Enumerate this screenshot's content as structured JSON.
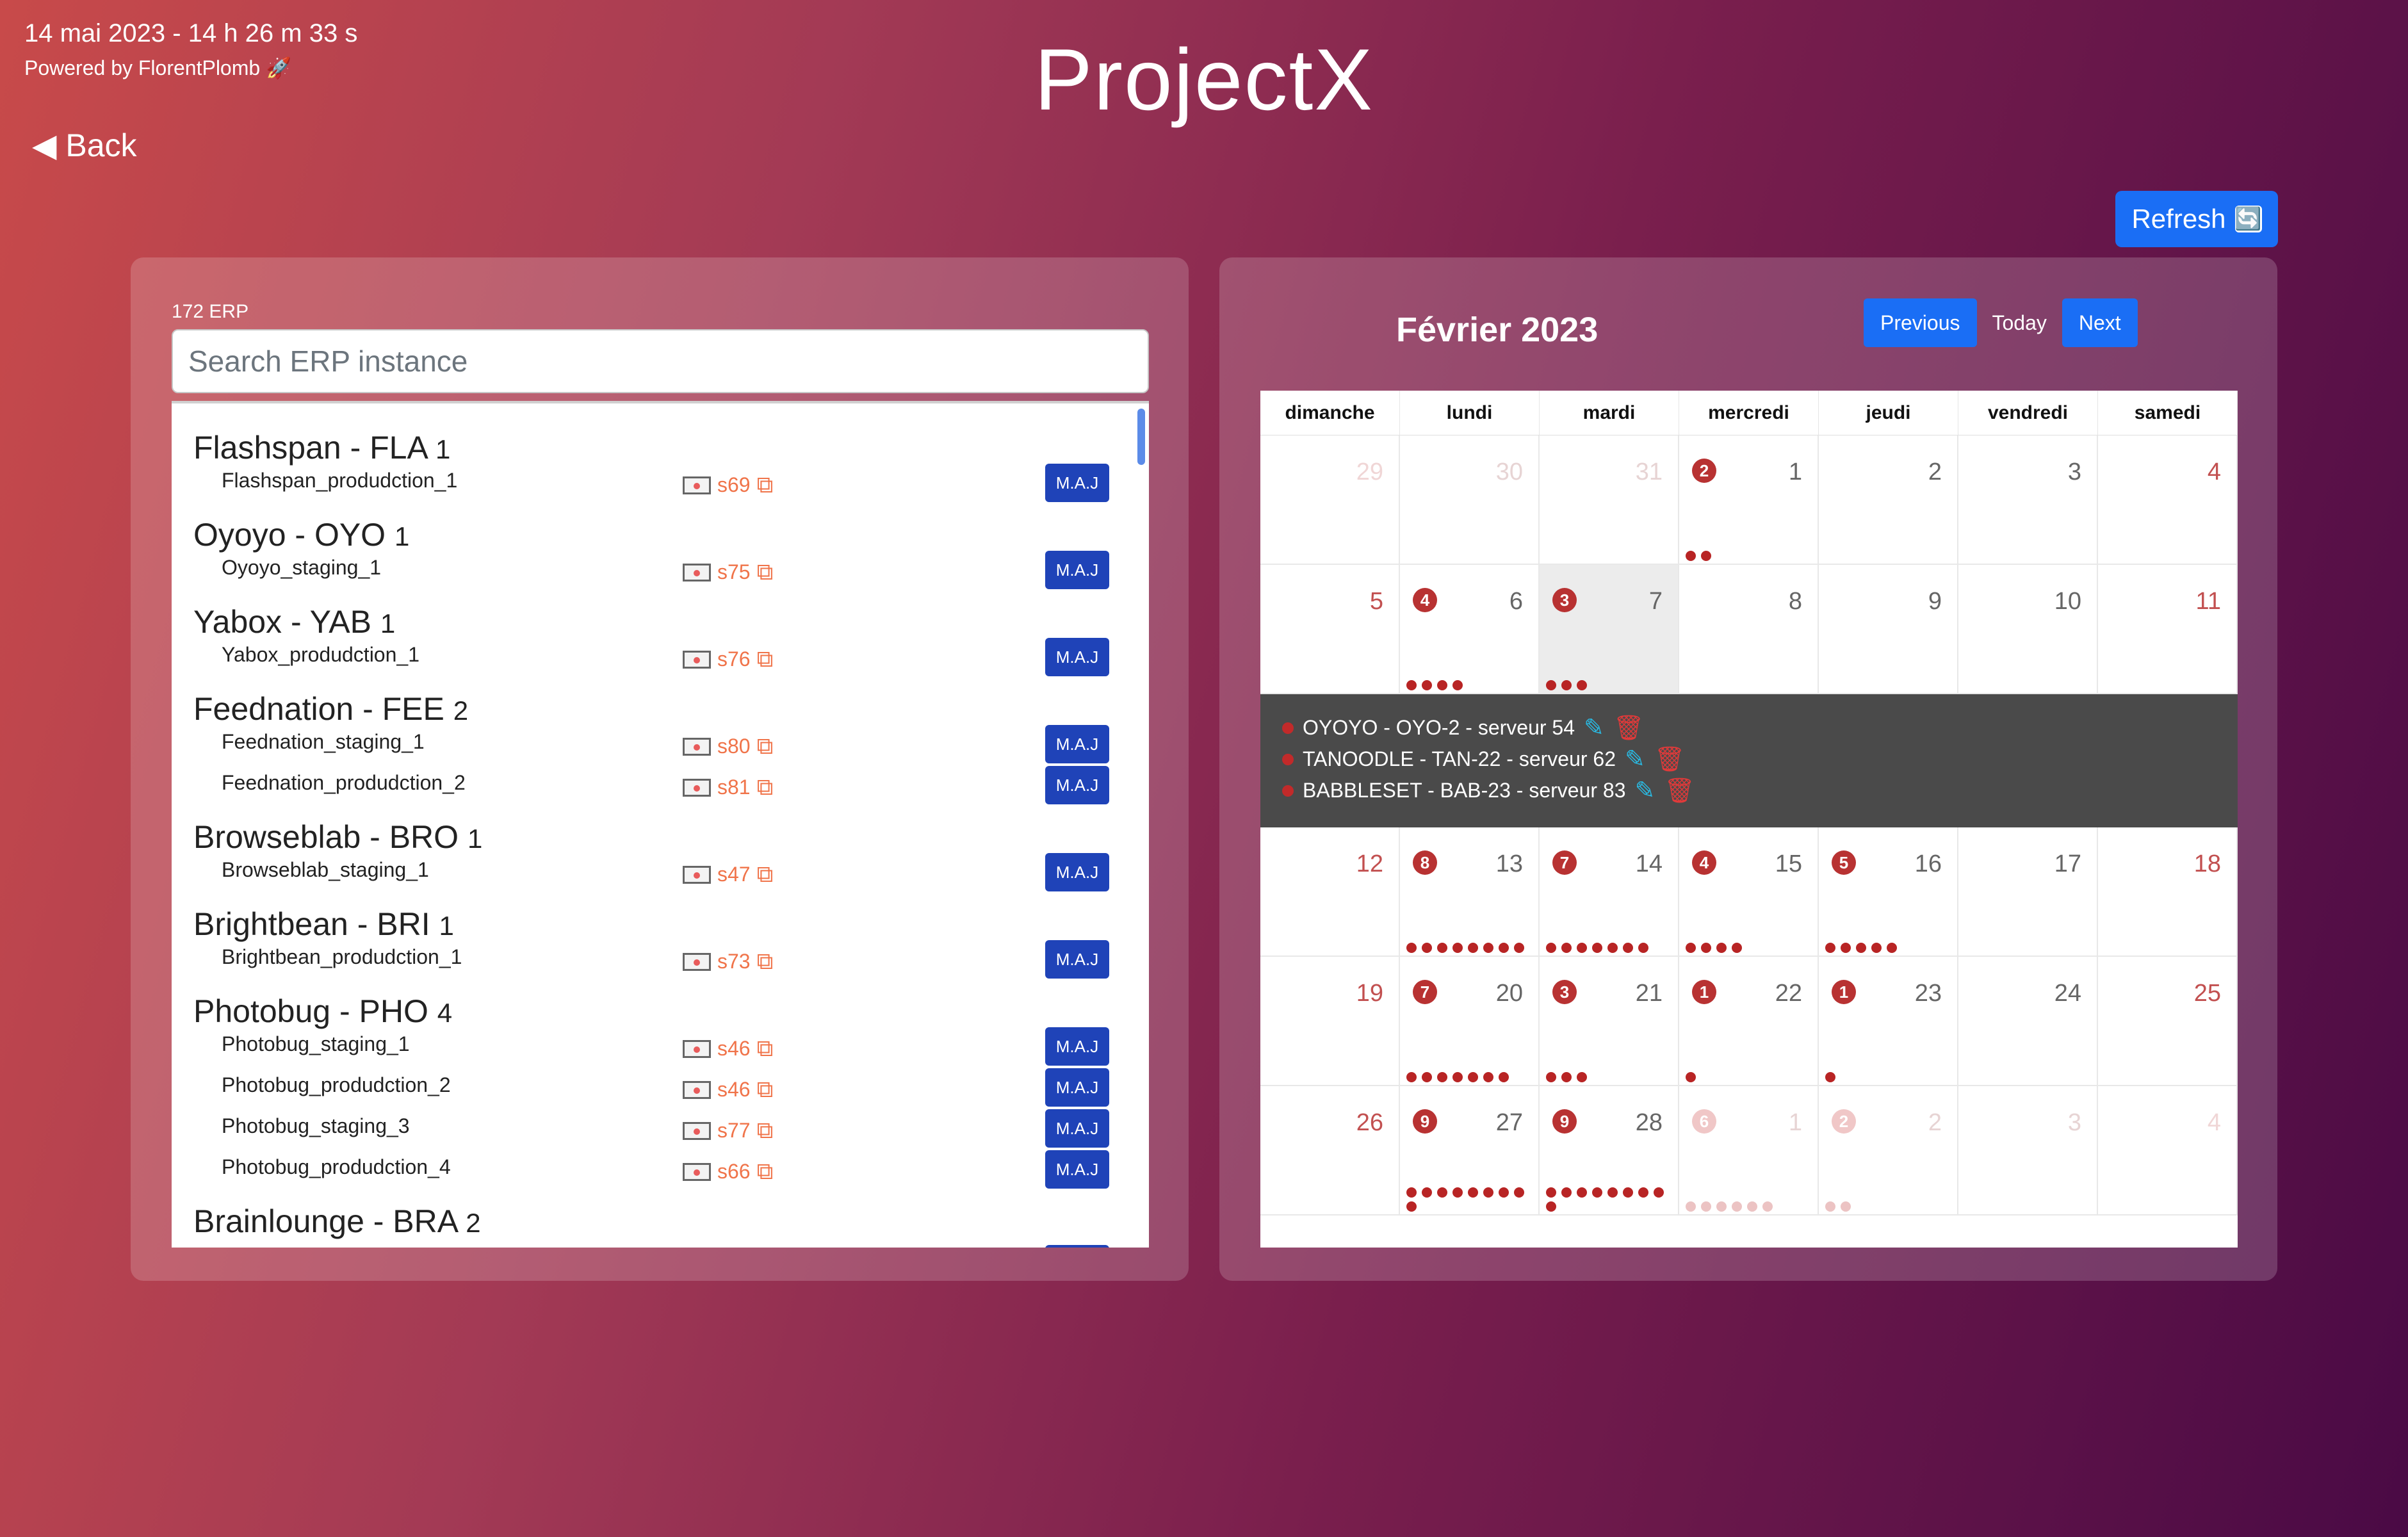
{
  "header": {
    "datetime": "14 mai 2023 - 14 h 26 m 33 s",
    "powered_by": "Powered by FlorentPlomb 🚀",
    "app_title": "ProjectX",
    "back_label": "◀ Back",
    "refresh_label": "Refresh",
    "refresh_icon": "🔄"
  },
  "erp": {
    "count_label": "172 ERP",
    "search_placeholder": "Search ERP instance",
    "maj_label": "M.A.J",
    "groups": [
      {
        "title": "Flashspan - FLA",
        "count": "1",
        "instances": [
          {
            "name": "Flashspan_produdction_1",
            "server": "s69"
          }
        ]
      },
      {
        "title": "Oyoyo - OYO",
        "count": "1",
        "instances": [
          {
            "name": "Oyoyo_staging_1",
            "server": "s75"
          }
        ]
      },
      {
        "title": "Yabox - YAB",
        "count": "1",
        "instances": [
          {
            "name": "Yabox_produdction_1",
            "server": "s76"
          }
        ]
      },
      {
        "title": "Feednation - FEE",
        "count": "2",
        "instances": [
          {
            "name": "Feednation_staging_1",
            "server": "s80"
          },
          {
            "name": "Feednation_produdction_2",
            "server": "s81"
          }
        ]
      },
      {
        "title": "Browseblab - BRO",
        "count": "1",
        "instances": [
          {
            "name": "Browseblab_staging_1",
            "server": "s47"
          }
        ]
      },
      {
        "title": "Brightbean - BRI",
        "count": "1",
        "instances": [
          {
            "name": "Brightbean_produdction_1",
            "server": "s73"
          }
        ]
      },
      {
        "title": "Photobug - PHO",
        "count": "4",
        "instances": [
          {
            "name": "Photobug_staging_1",
            "server": "s46"
          },
          {
            "name": "Photobug_produdction_2",
            "server": "s46"
          },
          {
            "name": "Photobug_staging_3",
            "server": "s77"
          },
          {
            "name": "Photobug_produdction_4",
            "server": "s66"
          }
        ]
      },
      {
        "title": "Brainlounge - BRA",
        "count": "2",
        "instances": []
      }
    ]
  },
  "calendar": {
    "title": "Février 2023",
    "previous_label": "Previous",
    "today_label": "Today",
    "next_label": "Next",
    "weekdays": [
      "dimanche",
      "lundi",
      "mardi",
      "mercredi",
      "jeudi",
      "vendredi",
      "samedi"
    ],
    "weeks": [
      [
        {
          "n": "29",
          "other": true
        },
        {
          "n": "30",
          "other": true
        },
        {
          "n": "31",
          "other": true
        },
        {
          "n": "1",
          "count": 2
        },
        {
          "n": "2"
        },
        {
          "n": "3"
        },
        {
          "n": "4"
        }
      ],
      [
        {
          "n": "5"
        },
        {
          "n": "6",
          "count": 4
        },
        {
          "n": "7",
          "count": 3,
          "selected": true
        },
        {
          "n": "8"
        },
        {
          "n": "9"
        },
        {
          "n": "10"
        },
        {
          "n": "11"
        }
      ],
      [
        {
          "n": "12"
        },
        {
          "n": "13",
          "count": 8
        },
        {
          "n": "14",
          "count": 7
        },
        {
          "n": "15",
          "count": 4
        },
        {
          "n": "16",
          "count": 5
        },
        {
          "n": "17"
        },
        {
          "n": "18"
        }
      ],
      [
        {
          "n": "19"
        },
        {
          "n": "20",
          "count": 7
        },
        {
          "n": "21",
          "count": 3
        },
        {
          "n": "22",
          "count": 1
        },
        {
          "n": "23",
          "count": 1
        },
        {
          "n": "24"
        },
        {
          "n": "25"
        }
      ],
      [
        {
          "n": "26"
        },
        {
          "n": "27",
          "count": 9
        },
        {
          "n": "28",
          "count": 9
        },
        {
          "n": "1",
          "count": 6,
          "other": true
        },
        {
          "n": "2",
          "count": 2,
          "other": true
        },
        {
          "n": "3",
          "other": true
        },
        {
          "n": "4",
          "other": true
        }
      ]
    ],
    "events": [
      {
        "label": "OYOYO - OYO-2 - serveur 54"
      },
      {
        "label": "TANOODLE - TAN-22 - serveur 62"
      },
      {
        "label": "BABBLESET - BAB-23 - serveur 83"
      }
    ],
    "edit_icon": "pencil-icon",
    "delete_icon": "trash-icon"
  },
  "colors": {
    "primary_button": "#1a6ef5",
    "maj_button": "#1f43b8",
    "server_link": "#f0744a",
    "event_dot": "#b82424"
  }
}
